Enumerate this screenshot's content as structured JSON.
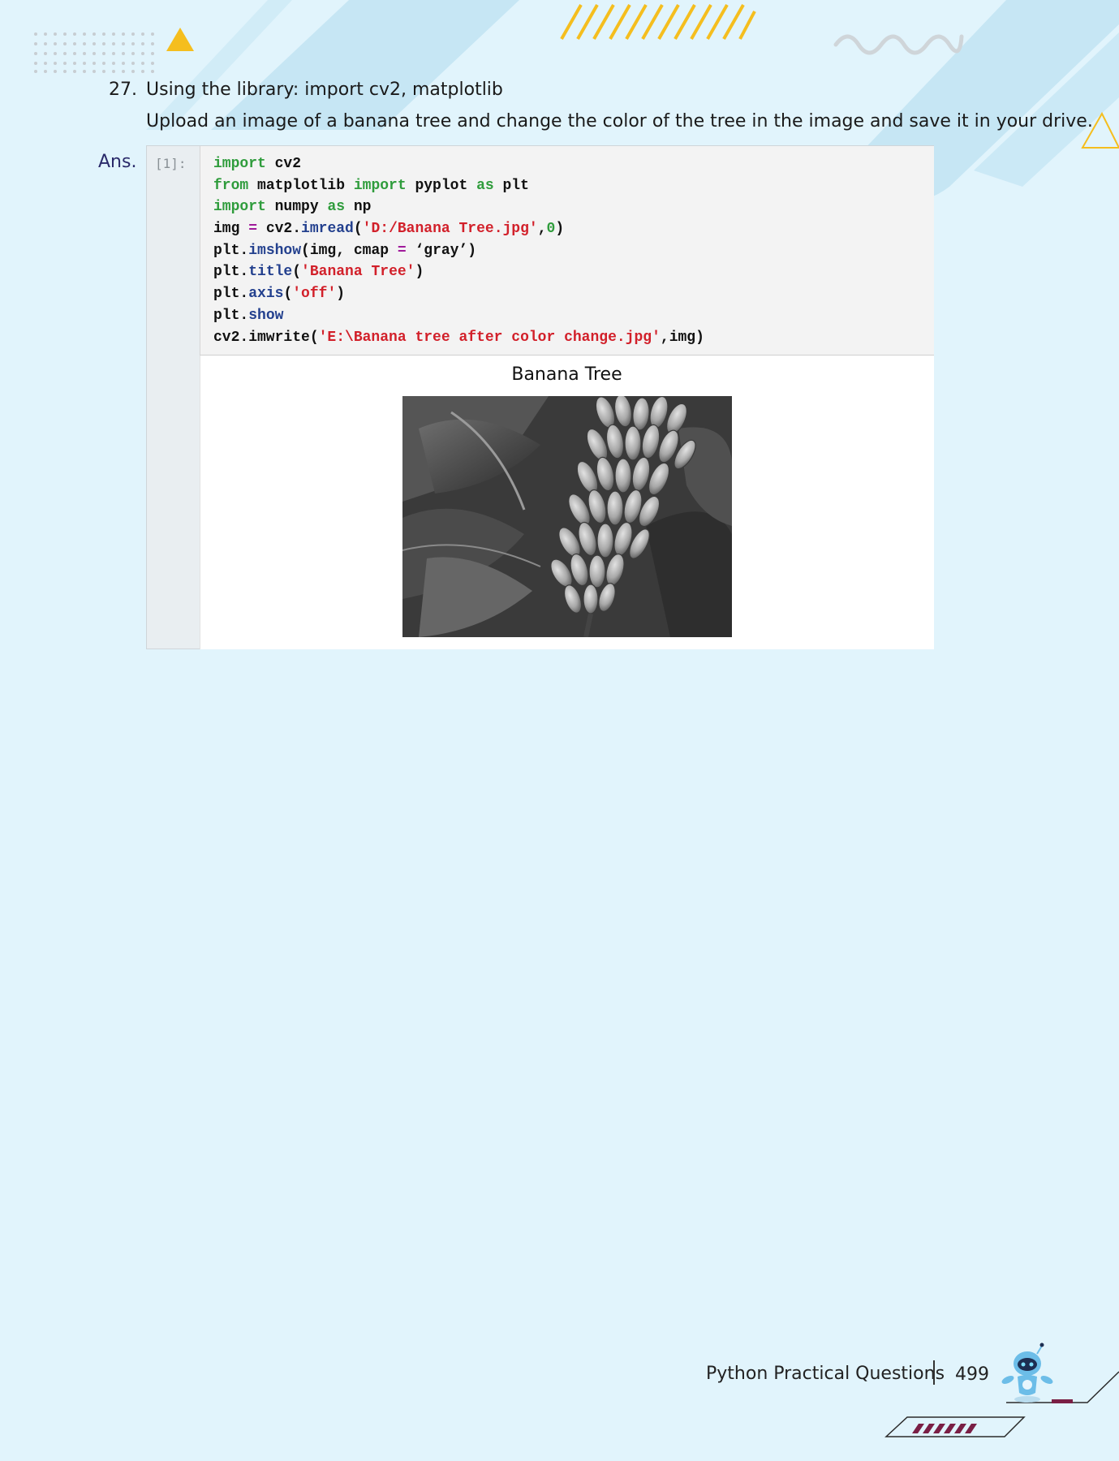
{
  "question": {
    "number": "27.",
    "text": "Using the library: import cv2, matplotlib",
    "subtext": "Upload an image of a banana tree and change the color of the tree in the image and save it in your drive."
  },
  "answer_label": "Ans.",
  "cell": {
    "prompt": "[1]:",
    "code_lines": [
      [
        [
          "kw",
          "import"
        ],
        [
          "t",
          " cv2"
        ]
      ],
      [
        [
          "kw",
          "from"
        ],
        [
          "t",
          " matplotlib "
        ],
        [
          "kw",
          "import"
        ],
        [
          "t",
          " pyplot "
        ],
        [
          "kw",
          "as"
        ],
        [
          "t",
          " plt"
        ]
      ],
      [
        [
          "kw",
          "import"
        ],
        [
          "t",
          " numpy "
        ],
        [
          "kw",
          "as"
        ],
        [
          "t",
          " np"
        ]
      ],
      [
        [
          "t",
          "img "
        ],
        [
          "op",
          "="
        ],
        [
          "t",
          " cv2."
        ],
        [
          "fn",
          "imread"
        ],
        [
          "t",
          "("
        ],
        [
          "str",
          "'D:/Banana Tree.jpg'"
        ],
        [
          "t",
          ","
        ],
        [
          "numv",
          "0"
        ],
        [
          "t",
          ")"
        ]
      ],
      [
        [
          "t",
          "plt."
        ],
        [
          "fn",
          "imshow"
        ],
        [
          "t",
          "(img, cmap "
        ],
        [
          "op",
          "="
        ],
        [
          "t",
          " ‘gray’)"
        ]
      ],
      [
        [
          "t",
          "plt."
        ],
        [
          "fn",
          "title"
        ],
        [
          "t",
          "("
        ],
        [
          "str",
          "'Banana Tree'"
        ],
        [
          "t",
          ")"
        ]
      ],
      [
        [
          "t",
          "plt."
        ],
        [
          "fn",
          "axis"
        ],
        [
          "t",
          "("
        ],
        [
          "str",
          "'off'"
        ],
        [
          "t",
          ")"
        ]
      ],
      [
        [
          "t",
          "plt."
        ],
        [
          "fn",
          "show"
        ]
      ],
      [
        [
          "t",
          "cv2.imwrite("
        ],
        [
          "str",
          "'E:\\Banana tree after color change.jpg'"
        ],
        [
          "t",
          ",img)"
        ]
      ]
    ],
    "output_title": "Banana Tree"
  },
  "footer": {
    "section": "Python Practical Questions",
    "page": "499"
  },
  "colors": {
    "background": "#e1f4fc",
    "keyword": "#2f9c3c",
    "function": "#23408e",
    "string": "#d2202a",
    "accent_yellow": "#f5be1e",
    "accent_maroon": "#7a1f45"
  }
}
